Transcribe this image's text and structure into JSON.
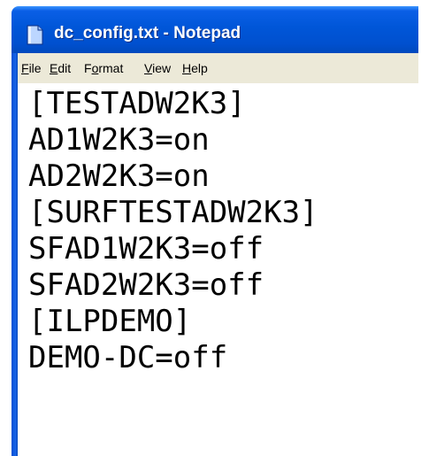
{
  "window": {
    "title": "dc_config.txt - Notepad",
    "icon": "notepad-icon",
    "colors": {
      "titlebar": "#0055d4",
      "menubar": "#ece9d8",
      "text": "#000000",
      "title_text": "#ffffff"
    }
  },
  "menu": {
    "items": [
      {
        "mnemonic": "F",
        "rest": "ile"
      },
      {
        "mnemonic": "E",
        "rest": "dit"
      },
      {
        "mnemonic": "",
        "rest": "F",
        "mnemonic2": "o",
        "rest2": "rmat"
      },
      {
        "mnemonic": "V",
        "rest": "iew"
      },
      {
        "mnemonic": "H",
        "rest": "elp"
      }
    ]
  },
  "editor": {
    "lines": [
      "[TESTADW2K3]",
      "AD1W2K3=on",
      "AD2W2K3=on",
      "[SURFTESTADW2K3]",
      "SFAD1W2K3=off",
      "SFAD2W2K3=off",
      "[ILPDEMO]",
      "DEMO-DC=off"
    ]
  }
}
